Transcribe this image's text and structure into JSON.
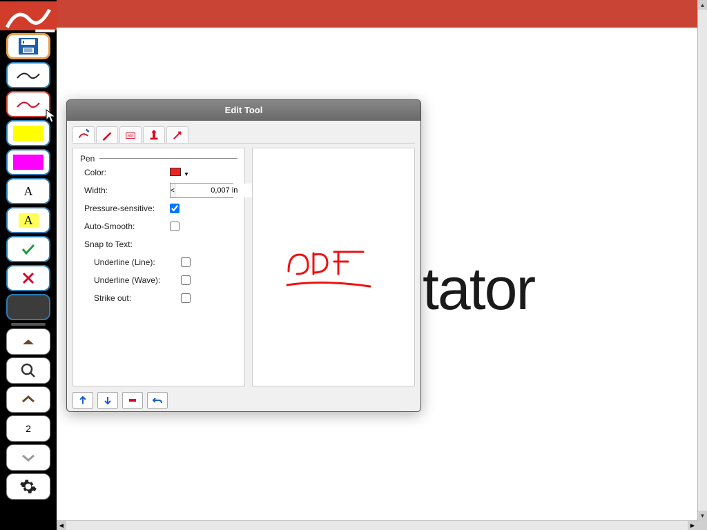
{
  "sidebar": {
    "page_number": "2"
  },
  "document": {
    "visible_text": "tator"
  },
  "dialog": {
    "title": "Edit Tool",
    "section": "Pen",
    "fields": {
      "color_label": "Color:",
      "color_value": "#e02020",
      "width_label": "Width:",
      "width_value": "0,007 in",
      "pressure_label": "Pressure-sensitive:",
      "pressure_checked": true,
      "autosmooth_label": "Auto-Smooth:",
      "autosmooth_checked": false,
      "snap_label": "Snap to Text:",
      "underline_line_label": "Underline (Line):",
      "underline_line_checked": false,
      "underline_wave_label": "Underline (Wave):",
      "underline_wave_checked": false,
      "strikeout_label": "Strike out:",
      "strikeout_checked": false
    },
    "preview_text": "PDF"
  }
}
